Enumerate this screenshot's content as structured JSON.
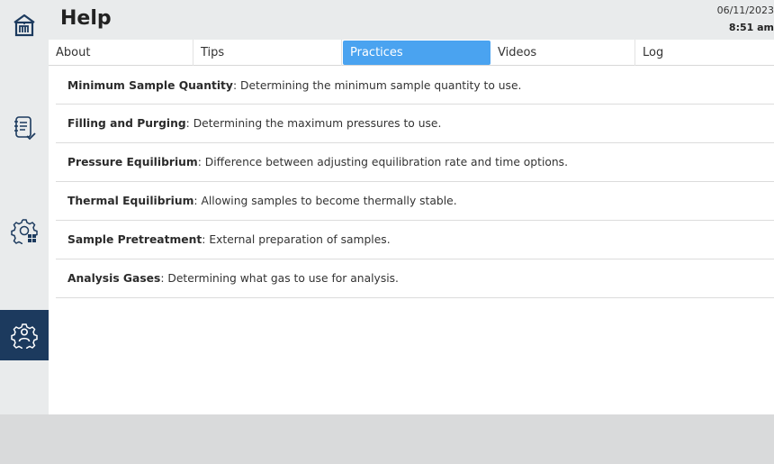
{
  "header": {
    "title": "Help",
    "date": "06/11/2023",
    "time": "8:51 am"
  },
  "sidebar": {
    "items": [
      {
        "icon": "home-icon",
        "selected": false
      },
      {
        "icon": "reports-icon",
        "selected": false
      },
      {
        "icon": "settings-icon",
        "selected": false
      },
      {
        "icon": "help-settings-icon",
        "selected": true
      }
    ]
  },
  "tabs": [
    {
      "label": "About"
    },
    {
      "label": "Tips"
    },
    {
      "label": "Practices",
      "active": true
    },
    {
      "label": "Videos"
    },
    {
      "label": "Log"
    }
  ],
  "practices": [
    {
      "title": "Minimum Sample Quantity",
      "desc": ": Determining the minimum sample quantity to use."
    },
    {
      "title": "Filling and Purging",
      "desc": ": Determining the maximum pressures to use."
    },
    {
      "title": "Pressure Equilibrium",
      "desc": ": Difference between adjusting equilibration rate and time options."
    },
    {
      "title": "Thermal Equilibrium",
      "desc": ": Allowing samples to become thermally stable."
    },
    {
      "title": "Sample Pretreatment",
      "desc": ": External preparation of samples."
    },
    {
      "title": "Analysis Gases",
      "desc": ": Determining what gas to use for analysis."
    }
  ],
  "colors": {
    "accent": "#4aa3f0",
    "sidebar_selected": "#1c3a5e",
    "sidebar_bg": "#e9ebec",
    "footer_bg": "#d9dadb"
  }
}
